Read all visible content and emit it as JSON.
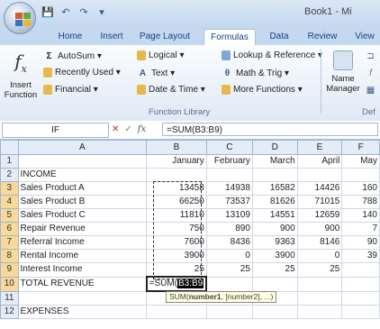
{
  "window": {
    "title": "Book1 - Mi"
  },
  "qat": {
    "save_icon": "💾",
    "undo_icon": "↶",
    "redo_icon": "↷",
    "more_icon": "▾"
  },
  "tabs": [
    "Home",
    "Insert",
    "Page Layout",
    "Formulas",
    "Data",
    "Review",
    "View"
  ],
  "active_tab": "Formulas",
  "ribbon": {
    "insert_function": {
      "line1": "Insert",
      "line2": "Function"
    },
    "autosum": "AutoSum ▾",
    "recently_used": "Recently Used ▾",
    "financial": "Financial ▾",
    "logical": "Logical ▾",
    "text": "Text ▾",
    "date_time": "Date & Time ▾",
    "lookup": "Lookup & Reference ▾",
    "math": "Math & Trig ▾",
    "more_functions": "More Functions ▾",
    "group_label": "Function Library",
    "name_manager": {
      "line1": "Name",
      "line2": "Manager"
    },
    "defined_label": "Def"
  },
  "formula_bar": {
    "name_box": "IF",
    "cancel": "✕",
    "enter": "✓",
    "fx": "fx",
    "formula": "=SUM(B3:B9)"
  },
  "columns": [
    "A",
    "B",
    "C",
    "D",
    "E",
    "F"
  ],
  "rows": [
    {
      "n": "1",
      "cells": [
        "",
        "January",
        "February",
        "March",
        "April",
        "May"
      ]
    },
    {
      "n": "2",
      "cells": [
        "INCOME",
        "",
        "",
        "",
        "",
        ""
      ]
    },
    {
      "n": "3",
      "cells": [
        "Sales Product A",
        "13458",
        "14938",
        "16582",
        "14426",
        "160"
      ]
    },
    {
      "n": "4",
      "cells": [
        "Sales Product B",
        "66250",
        "73537",
        "81626",
        "71015",
        "788"
      ]
    },
    {
      "n": "5",
      "cells": [
        "Sales Product C",
        "11810",
        "13109",
        "14551",
        "12659",
        "140"
      ]
    },
    {
      "n": "6",
      "cells": [
        "Repair Revenue",
        "750",
        "890",
        "900",
        "900",
        "7"
      ]
    },
    {
      "n": "7",
      "cells": [
        "Referral Income",
        "7600",
        "8436",
        "9363",
        "8146",
        "90"
      ]
    },
    {
      "n": "8",
      "cells": [
        "Rental Income",
        "3900",
        "0",
        "3900",
        "0",
        "39"
      ]
    },
    {
      "n": "9",
      "cells": [
        "Interest Income",
        "25",
        "25",
        "25",
        "25",
        ""
      ]
    },
    {
      "n": "10",
      "cells": [
        "TOTAL REVENUE",
        "",
        "",
        "",
        "",
        ""
      ]
    },
    {
      "n": "11",
      "cells": [
        "",
        "",
        "",
        "",
        "",
        ""
      ]
    },
    {
      "n": "12",
      "cells": [
        "EXPENSES",
        "",
        "",
        "",
        "",
        ""
      ]
    }
  ],
  "active_cell_text": {
    "prefix": "=SUM(",
    "ref": "B3:B9"
  },
  "tooltip": {
    "fn": "SUM(",
    "arg1": "number1",
    "rest": ", [number2], ...)"
  }
}
